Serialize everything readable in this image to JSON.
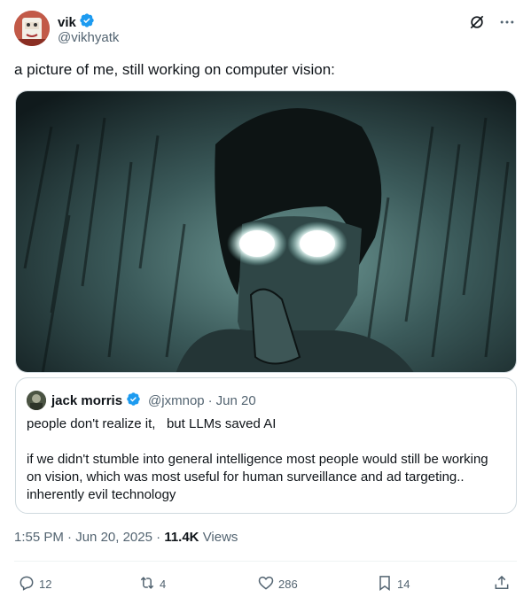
{
  "author": {
    "name": "vik",
    "handle": "@vikhyatk",
    "verified": true
  },
  "tweet": {
    "text": "a picture of me, still working on computer vision:"
  },
  "quote": {
    "name": "jack morris",
    "handle": "@jxmnop",
    "separator": "·",
    "date": "Jun 20",
    "verified": true,
    "text": "people don't realize it,   but LLMs saved AI\n\nif we didn't stumble into general intelligence most people would still be working on vision, which was most useful for human surveillance and ad targeting.. inherently evil technology"
  },
  "meta": {
    "time": "1:55 PM",
    "dot1": "·",
    "date": "Jun 20, 2025",
    "dot2": "·",
    "views_count": "11.4K",
    "views_label": "Views"
  },
  "actions": {
    "replies": "12",
    "reposts": "4",
    "likes": "286",
    "bookmarks": "14"
  },
  "icons": {
    "verified": "verified-badge-icon",
    "grok": "grok-icon",
    "more": "more-icon",
    "reply": "reply-icon",
    "repost": "repost-icon",
    "like": "like-icon",
    "bookmark": "bookmark-icon",
    "share": "share-icon"
  },
  "colors": {
    "verified": "#1d9bf0",
    "text": "#0f1419",
    "secondary": "#536471",
    "border": "#cfd9de"
  }
}
